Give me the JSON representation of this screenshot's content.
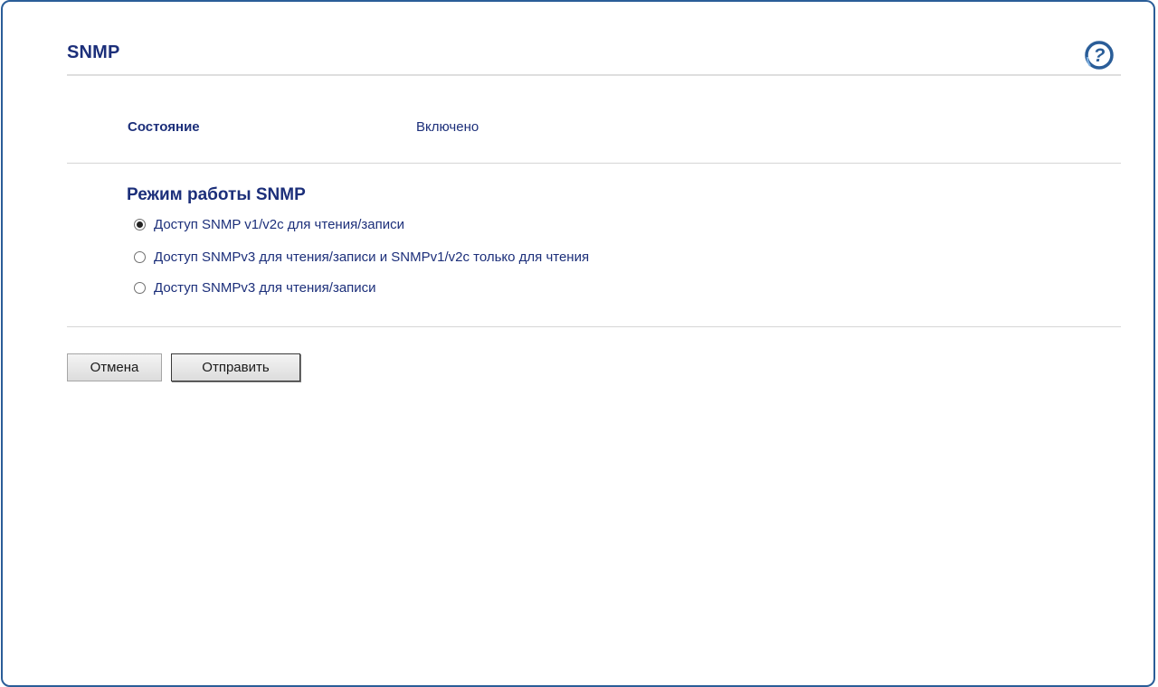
{
  "page": {
    "title": "SNMP"
  },
  "icons": {
    "help": "help-icon"
  },
  "colors": {
    "heading": "#1c2f7a",
    "border": "#2a5d98",
    "help_icon": "#2a5d98"
  },
  "status": {
    "label": "Состояние",
    "value": "Включено"
  },
  "snmp_mode": {
    "title": "Режим работы SNMP",
    "selected_index": 0,
    "options": [
      {
        "label": "Доступ SNMP v1/v2c для чтения/записи",
        "checked": true
      },
      {
        "label": "Доступ SNMPv3 для чтения/записи и SNMPv1/v2c только для чтения",
        "checked": false
      },
      {
        "label": "Доступ SNMPv3 для чтения/записи",
        "checked": false
      }
    ]
  },
  "buttons": {
    "cancel": "Отмена",
    "submit": "Отправить"
  }
}
